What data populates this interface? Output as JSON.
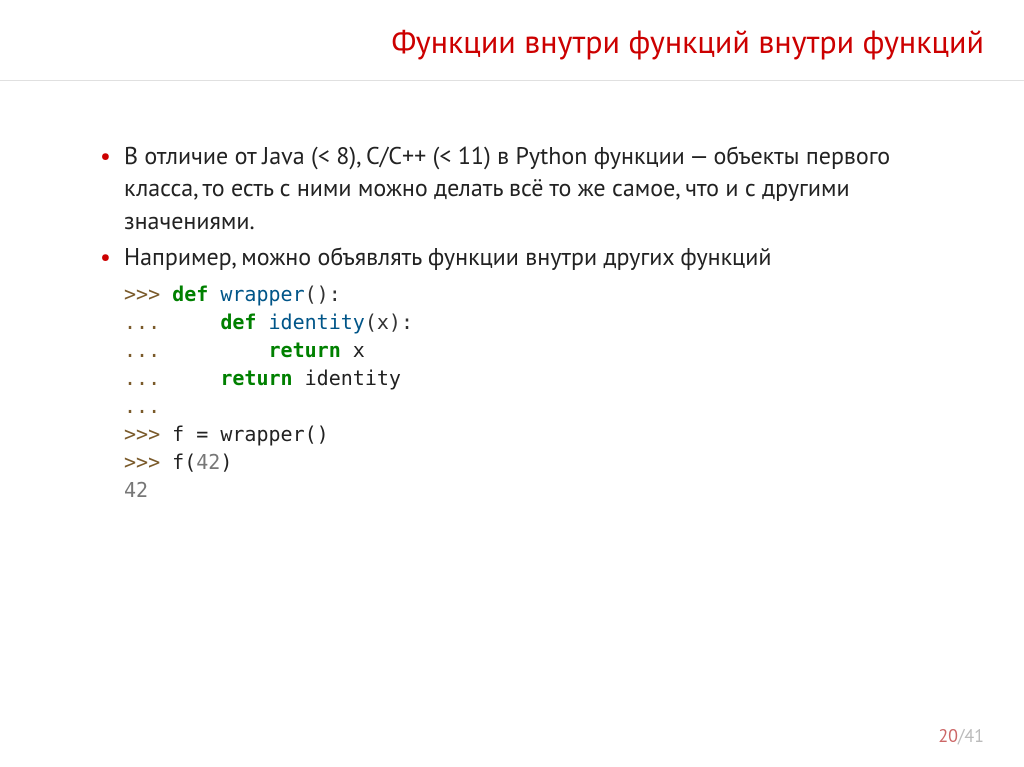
{
  "title": "Функции внутри функций внутри функций",
  "bullets": [
    "В отличие от Java (< 8), С/С++ (< 11) в Python функции — объекты первого класса, то есть с ними можно делать всё то же самое, что и с другими значениями.",
    "Например, можно объявлять функции внутри других функций"
  ],
  "code": {
    "l1_prompt": ">>> ",
    "l1_kw": "def",
    "l1_id": " wrapper",
    "l1_punc": "():",
    "l2_prompt": "...     ",
    "l2_kw": "def",
    "l2_id": " identity",
    "l2_punc": "(x):",
    "l3_prompt": "...         ",
    "l3_kw": "return",
    "l3_rest": " x",
    "l4_prompt": "...     ",
    "l4_kw": "return",
    "l4_rest": " identity",
    "l5_prompt": "...",
    "l6_prompt": ">>> ",
    "l6_rest": "f = wrapper()",
    "l7_prompt": ">>> ",
    "l7_rest1": "f(",
    "l7_num": "42",
    "l7_rest2": ")",
    "l8_out": "42"
  },
  "footer": {
    "cur": "20",
    "sep": "/",
    "total": "41"
  }
}
